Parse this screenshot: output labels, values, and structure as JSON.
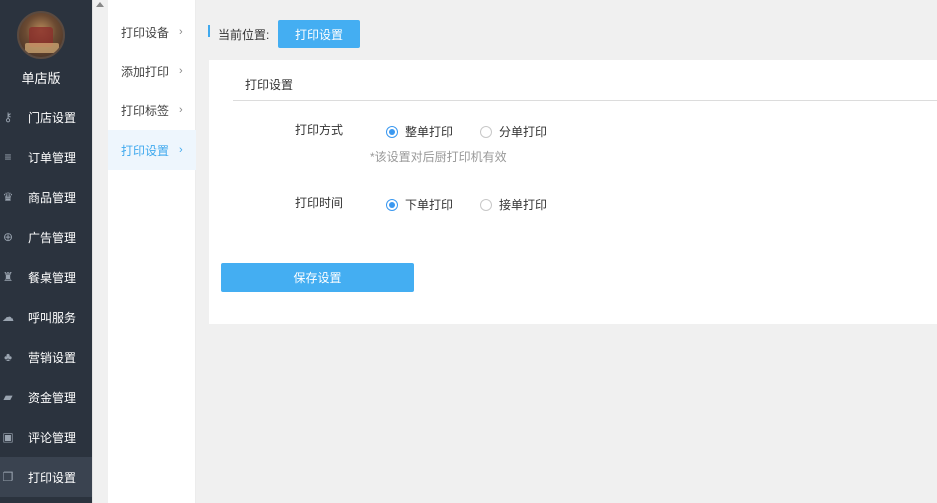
{
  "sidebar": {
    "store_name": "单店版",
    "items": [
      {
        "label": "门店设置",
        "icon": "key-icon",
        "glyph": "⚷"
      },
      {
        "label": "订单管理",
        "icon": "list-icon",
        "glyph": "≡"
      },
      {
        "label": "商品管理",
        "icon": "trophy-icon",
        "glyph": "♛"
      },
      {
        "label": "广告管理",
        "icon": "lifebuoy-icon",
        "glyph": "⊕"
      },
      {
        "label": "餐桌管理",
        "icon": "binoculars-icon",
        "glyph": "♜"
      },
      {
        "label": "呼叫服务",
        "icon": "cloud-icon",
        "glyph": "☁"
      },
      {
        "label": "营销设置",
        "icon": "gift-icon",
        "glyph": "♣"
      },
      {
        "label": "资金管理",
        "icon": "book-icon",
        "glyph": "▰"
      },
      {
        "label": "评论管理",
        "icon": "money-icon",
        "glyph": "▣"
      },
      {
        "label": "打印设置",
        "icon": "copy-icon",
        "glyph": "❐"
      }
    ]
  },
  "subnav": {
    "items": [
      {
        "label": "打印设备"
      },
      {
        "label": "添加打印"
      },
      {
        "label": "打印标签"
      },
      {
        "label": "打印设置"
      }
    ],
    "chevron": "›"
  },
  "breadcrumb": {
    "label": "当前位置:",
    "current": "打印设置"
  },
  "panel": {
    "title": "打印设置",
    "print_mode": {
      "label": "打印方式",
      "options": [
        "整单打印",
        "分单打印"
      ],
      "selected": "整单打印",
      "hint": "*该设置对后厨打印机有效"
    },
    "print_time": {
      "label": "打印时间",
      "options": [
        "下单打印",
        "接单打印"
      ],
      "selected": "下单打印"
    },
    "save_label": "保存设置"
  },
  "colors": {
    "accent": "#44aef2",
    "sidebar_bg": "#2b333e"
  }
}
